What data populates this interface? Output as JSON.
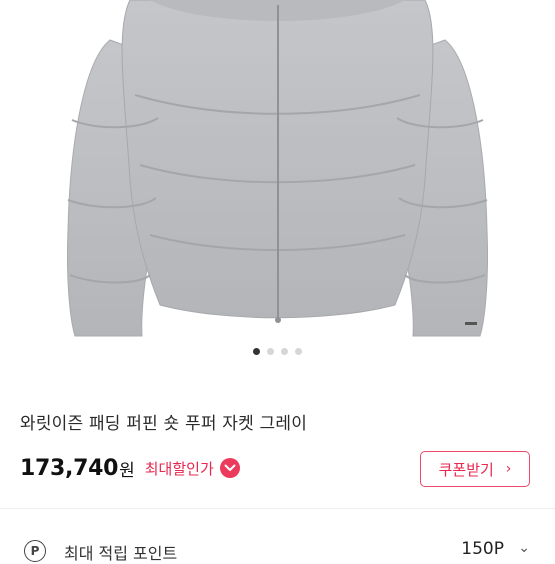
{
  "product": {
    "title": "와릿이즌 패딩 퍼핀 숏 푸퍼 자켓 그레이",
    "price": "173,740",
    "price_unit": "원",
    "discount_label": "최대할인가",
    "jacket_color": "#bdbfc3"
  },
  "gallery": {
    "total_images": 4,
    "active_index": 0
  },
  "coupon": {
    "label": "쿠폰받기",
    "chevron": "›"
  },
  "points": {
    "icon_letter": "P",
    "label": "최대 적립 포인트",
    "value": "150P",
    "chevron": "⌄"
  },
  "colors": {
    "accent": "#e8284f",
    "active_dot": "#333333",
    "inactive_dot": "#d6d6d6"
  }
}
